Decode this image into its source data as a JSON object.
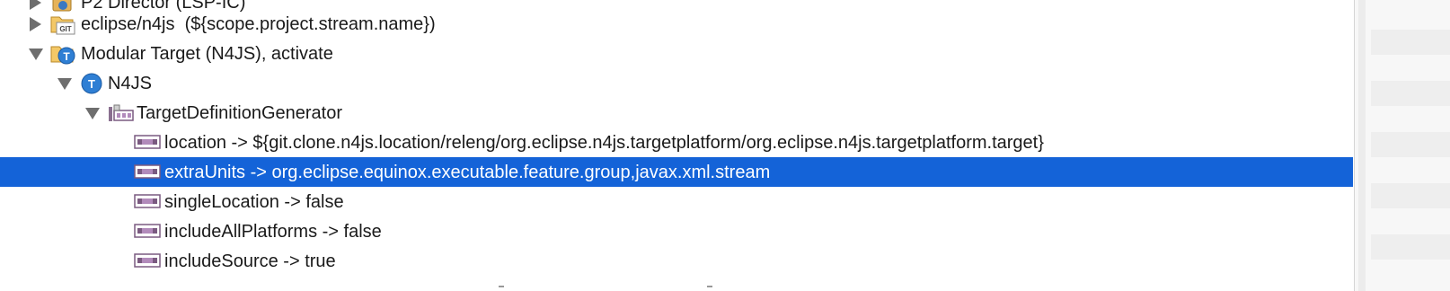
{
  "tree": {
    "top_partial_label": "P2 Director (LSP-IC)",
    "rows": [
      {
        "label": "eclipse/n4js  (${scope.project.stream.name})",
        "icon": "git-folder-icon",
        "expanded": false
      },
      {
        "label": "Modular Target (N4JS), activate",
        "icon": "target-folder-icon",
        "expanded": true
      },
      {
        "label": "N4JS",
        "icon": "target-icon",
        "expanded": true
      },
      {
        "label": "TargetDefinitionGenerator",
        "icon": "generator-icon",
        "expanded": true
      },
      {
        "label": "location -> ${git.clone.n4js.location/releng/org.eclipse.n4js.targetplatform/org.eclipse.n4js.targetplatform.target}",
        "icon": "property-icon"
      },
      {
        "label": "extraUnits -> org.eclipse.equinox.executable.feature.group,javax.xml.stream",
        "icon": "property-icon",
        "selected": true
      },
      {
        "label": "singleLocation -> false",
        "icon": "property-icon"
      },
      {
        "label": "includeAllPlatforms -> false",
        "icon": "property-icon"
      },
      {
        "label": "includeSource -> true",
        "icon": "property-icon"
      }
    ]
  },
  "colors": {
    "selection": "#1463d8",
    "text": "#1a1a1a",
    "background": "#ffffff"
  }
}
